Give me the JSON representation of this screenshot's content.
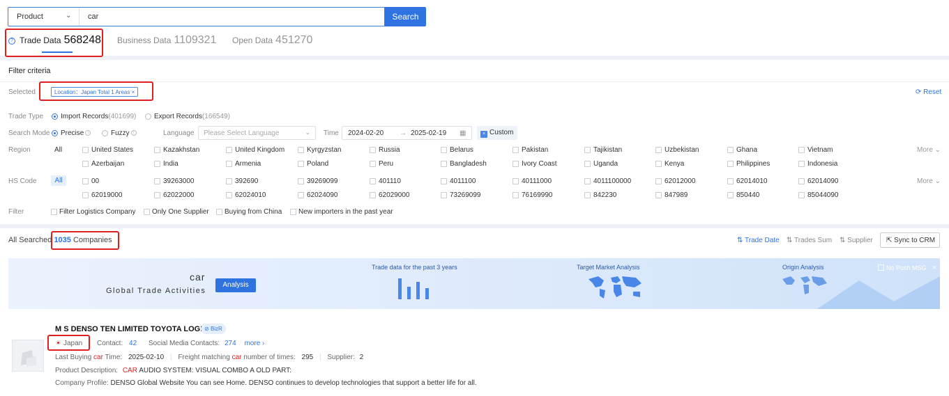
{
  "search": {
    "category": "Product",
    "query": "car",
    "button_label": "Search"
  },
  "tabs": [
    {
      "label": "Trade Data",
      "count": "568248"
    },
    {
      "label": "Business Data",
      "count": "1109321"
    },
    {
      "label": "Open Data",
      "count": "451270"
    }
  ],
  "filter": {
    "title": "Filter criteria",
    "selected_label": "Selected",
    "selected_chip": "Location：Japan Total 1 Areas",
    "reset_label": "Reset",
    "trade_type_label": "Trade Type",
    "import_label": "Import Records",
    "import_count": "(401699)",
    "export_label": "Export Records",
    "export_count": "(166549)",
    "search_mode_label": "Search Mode",
    "precise_label": "Precise",
    "fuzzy_label": "Fuzzy",
    "language_label": "Language",
    "language_placeholder": "Please Select Language",
    "time_label": "Time",
    "date_from": "2024-02-20",
    "date_to": "2025-02-19",
    "custom_label": "Custom",
    "region_label": "Region",
    "region_all": "All",
    "regions": [
      "United States",
      "Kazakhstan",
      "United Kingdom",
      "Kyrgyzstan",
      "Russia",
      "Belarus",
      "Pakistan",
      "Tajikistan",
      "Uzbekistan",
      "Ghana",
      "Vietnam",
      "Azerbaijan",
      "India",
      "Armenia",
      "Poland",
      "Peru",
      "Bangladesh",
      "Ivory Coast",
      "Uganda",
      "Kenya",
      "Philippines",
      "Indonesia"
    ],
    "more_label": "More",
    "hs_label": "HS Code",
    "hs_all": "All",
    "hs_codes": [
      "00",
      "39263000",
      "392690",
      "39269099",
      "401110",
      "4011100",
      "40111000",
      "4011100000",
      "62012000",
      "62014010",
      "62014090",
      "62019000",
      "62022000",
      "62024010",
      "62024090",
      "62029000",
      "73269099",
      "76169990",
      "842230",
      "847989",
      "850440",
      "85044090"
    ],
    "filter_label": "Filter",
    "filter_options": [
      "Filter Logistics Company",
      "Only One Supplier",
      "Buying from China",
      "New importers in the past year"
    ]
  },
  "results": {
    "all_searched": "All Searched",
    "count": "1035",
    "companies": "Companies",
    "sort_options": [
      "Trade Date",
      "Trades Sum",
      "Supplier"
    ],
    "sync_label": "Sync to CRM",
    "banner": {
      "keyword": "car",
      "subtitle": "Global Trade Activities",
      "analysis_label": "Analysis",
      "section1": "Trade data for the past 3 years",
      "section2": "Target Market Analysis",
      "section3": "Origin Analysis",
      "no_push": "No Push MSG"
    },
    "company": {
      "name": "M S DENSO TEN LIMITED TOYOTA LOGIS",
      "badge": "BizR",
      "country": "Japan",
      "contact_label": "Contact:",
      "contact_count": "42",
      "social_label": "Social Media Contacts:",
      "social_count": "274",
      "more_label": "more",
      "last_buying_pre": "Last Buying",
      "last_buying_kw": "car",
      "last_buying_post": "Time:",
      "last_buying_date": "2025-02-10",
      "freight_pre": "Freight matching",
      "freight_kw": "car",
      "freight_post": "number of times:",
      "freight_count": "295",
      "supplier_label": "Supplier:",
      "supplier_count": "2",
      "product_desc_label": "Product Description:",
      "product_desc_kw": "CAR",
      "product_desc_text": "AUDIO SYSTEM: VISUAL COMBO A OLD PART:",
      "profile_label": "Company Profile:",
      "profile_text": "DENSO Global Website You can see Home. DENSO continues to develop technologies that support a better life for all."
    }
  },
  "colors": {
    "accent": "#2f73e0",
    "highlight": "#e02020"
  }
}
